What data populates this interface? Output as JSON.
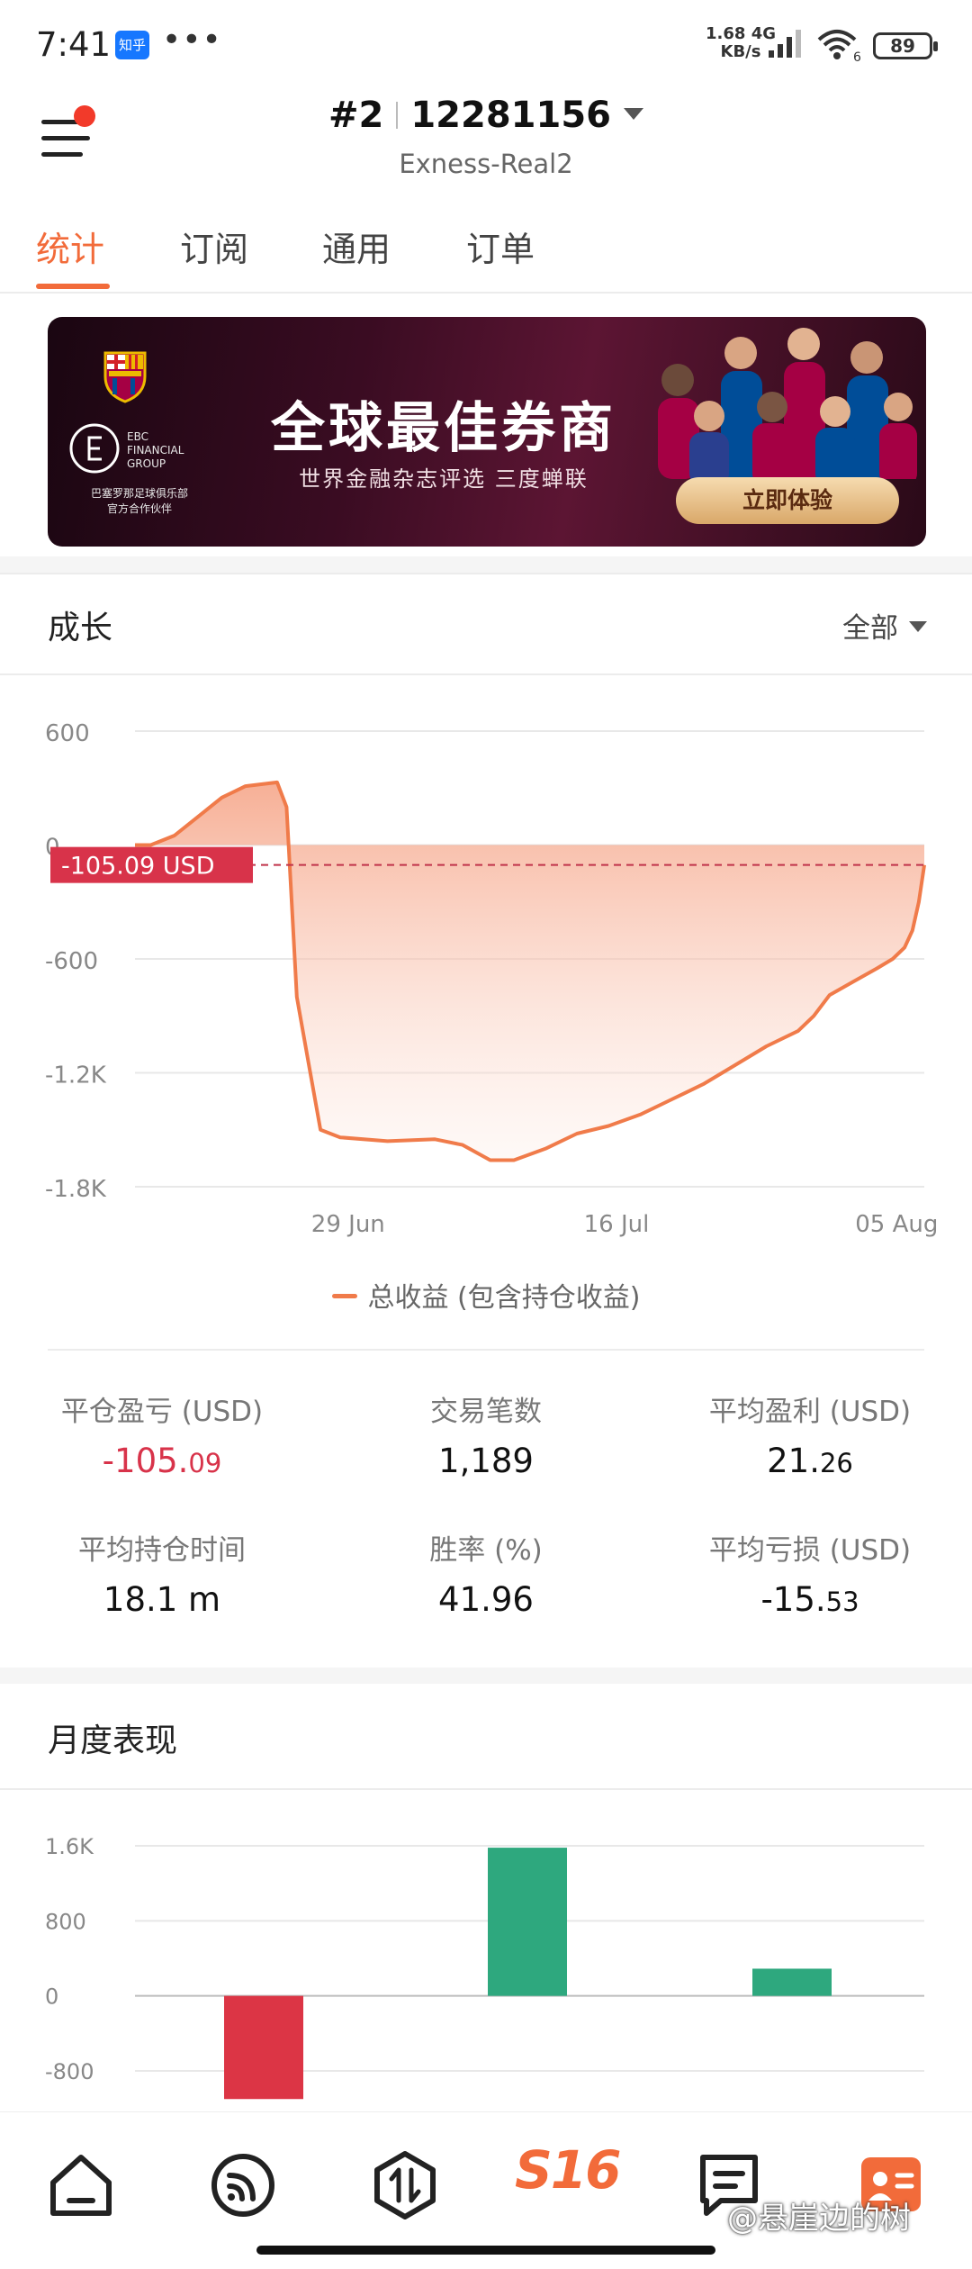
{
  "status_bar": {
    "time": "7:41",
    "app_icon_label": "知乎",
    "more": "•••",
    "net_speed_value": "1.68",
    "net_speed_unit": "KB/s",
    "network_type": "4G",
    "wifi_label": "6",
    "battery": "89"
  },
  "header": {
    "account_index": "#2",
    "account_number": "12281156",
    "server": "Exness-Real2"
  },
  "tabs": [
    {
      "label": "统计",
      "active": true
    },
    {
      "label": "订阅",
      "active": false
    },
    {
      "label": "通用",
      "active": false
    },
    {
      "label": "订单",
      "active": false
    }
  ],
  "banner": {
    "headline": "全球最佳券商",
    "subline": "世界金融杂志评选 三度蝉联",
    "cta": "立即体验",
    "brand_lines": [
      "EBC",
      "FINANCIAL",
      "GROUP"
    ],
    "partner_lines": [
      "巴塞罗那足球俱乐部",
      "官方合作伙伴"
    ]
  },
  "growth": {
    "title": "成长",
    "filter": "全部",
    "legend": "总收益 (包含持仓收益)"
  },
  "stats": [
    {
      "label": "平仓盈亏 (USD)",
      "int": "-105.",
      "dec": "09",
      "negative": true
    },
    {
      "label": "交易笔数",
      "int": "1,189",
      "dec": "",
      "negative": false
    },
    {
      "label": "平均盈利 (USD)",
      "int": "21.",
      "dec": "26",
      "negative": false
    },
    {
      "label": "平均持仓时间",
      "int": "18.1 m",
      "dec": "",
      "negative": false
    },
    {
      "label": "胜率 (%)",
      "int": "41.96",
      "dec": "",
      "negative": false
    },
    {
      "label": "平均亏损 (USD)",
      "int": "-15.",
      "dec": "53",
      "negative": false
    }
  ],
  "monthly": {
    "title": "月度表现"
  },
  "watermark": "@悬崖边的树",
  "nav": {
    "center_label": "S16"
  },
  "colors": {
    "accent": "#f26b3a",
    "line": "#f07b4a",
    "negative": "#d8334a",
    "positive_bar": "#2ea87e",
    "negative_bar": "#dc3545"
  },
  "chart_data": [
    {
      "type": "area",
      "title": "",
      "xlabel": "",
      "ylabel": "",
      "x_tick_labels": [
        "29 Jun",
        "16 Jul",
        "05 Aug"
      ],
      "y_tick_labels": [
        "600",
        "0",
        "-600",
        "-1.2K",
        "-1.8K"
      ],
      "y_ticks": [
        600,
        0,
        -600,
        -1200,
        -1800
      ],
      "ylim": [
        -1800,
        600
      ],
      "grid": true,
      "legend": "bottom",
      "series": [
        {
          "name": "总收益 (包含持仓收益)",
          "points": [
            [
              0,
              0
            ],
            [
              0.02,
              0
            ],
            [
              0.05,
              50
            ],
            [
              0.08,
              150
            ],
            [
              0.11,
              250
            ],
            [
              0.14,
              310
            ],
            [
              0.18,
              330
            ],
            [
              0.192,
              200
            ],
            [
              0.205,
              -800
            ],
            [
              0.22,
              -1150
            ],
            [
              0.235,
              -1500
            ],
            [
              0.26,
              -1540
            ],
            [
              0.32,
              -1560
            ],
            [
              0.38,
              -1550
            ],
            [
              0.415,
              -1580
            ],
            [
              0.45,
              -1660
            ],
            [
              0.48,
              -1660
            ],
            [
              0.52,
              -1600
            ],
            [
              0.56,
              -1520
            ],
            [
              0.6,
              -1480
            ],
            [
              0.64,
              -1420
            ],
            [
              0.68,
              -1340
            ],
            [
              0.72,
              -1260
            ],
            [
              0.76,
              -1160
            ],
            [
              0.8,
              -1060
            ],
            [
              0.84,
              -980
            ],
            [
              0.86,
              -900
            ],
            [
              0.88,
              -790
            ],
            [
              0.91,
              -720
            ],
            [
              0.94,
              -650
            ],
            [
              0.96,
              -600
            ],
            [
              0.975,
              -540
            ],
            [
              0.985,
              -450
            ],
            [
              0.993,
              -300
            ],
            [
              1.0,
              -105.09
            ]
          ]
        }
      ],
      "annotation": {
        "label": "-105.09 USD",
        "value": -105.09
      }
    },
    {
      "type": "bar",
      "title": "月度表现",
      "y_tick_labels": [
        "1.6K",
        "800",
        "0",
        "-800"
      ],
      "ylim": [
        -800,
        1600
      ],
      "series": [
        {
          "values": [
            -1100,
            1580,
            290
          ]
        }
      ]
    }
  ]
}
